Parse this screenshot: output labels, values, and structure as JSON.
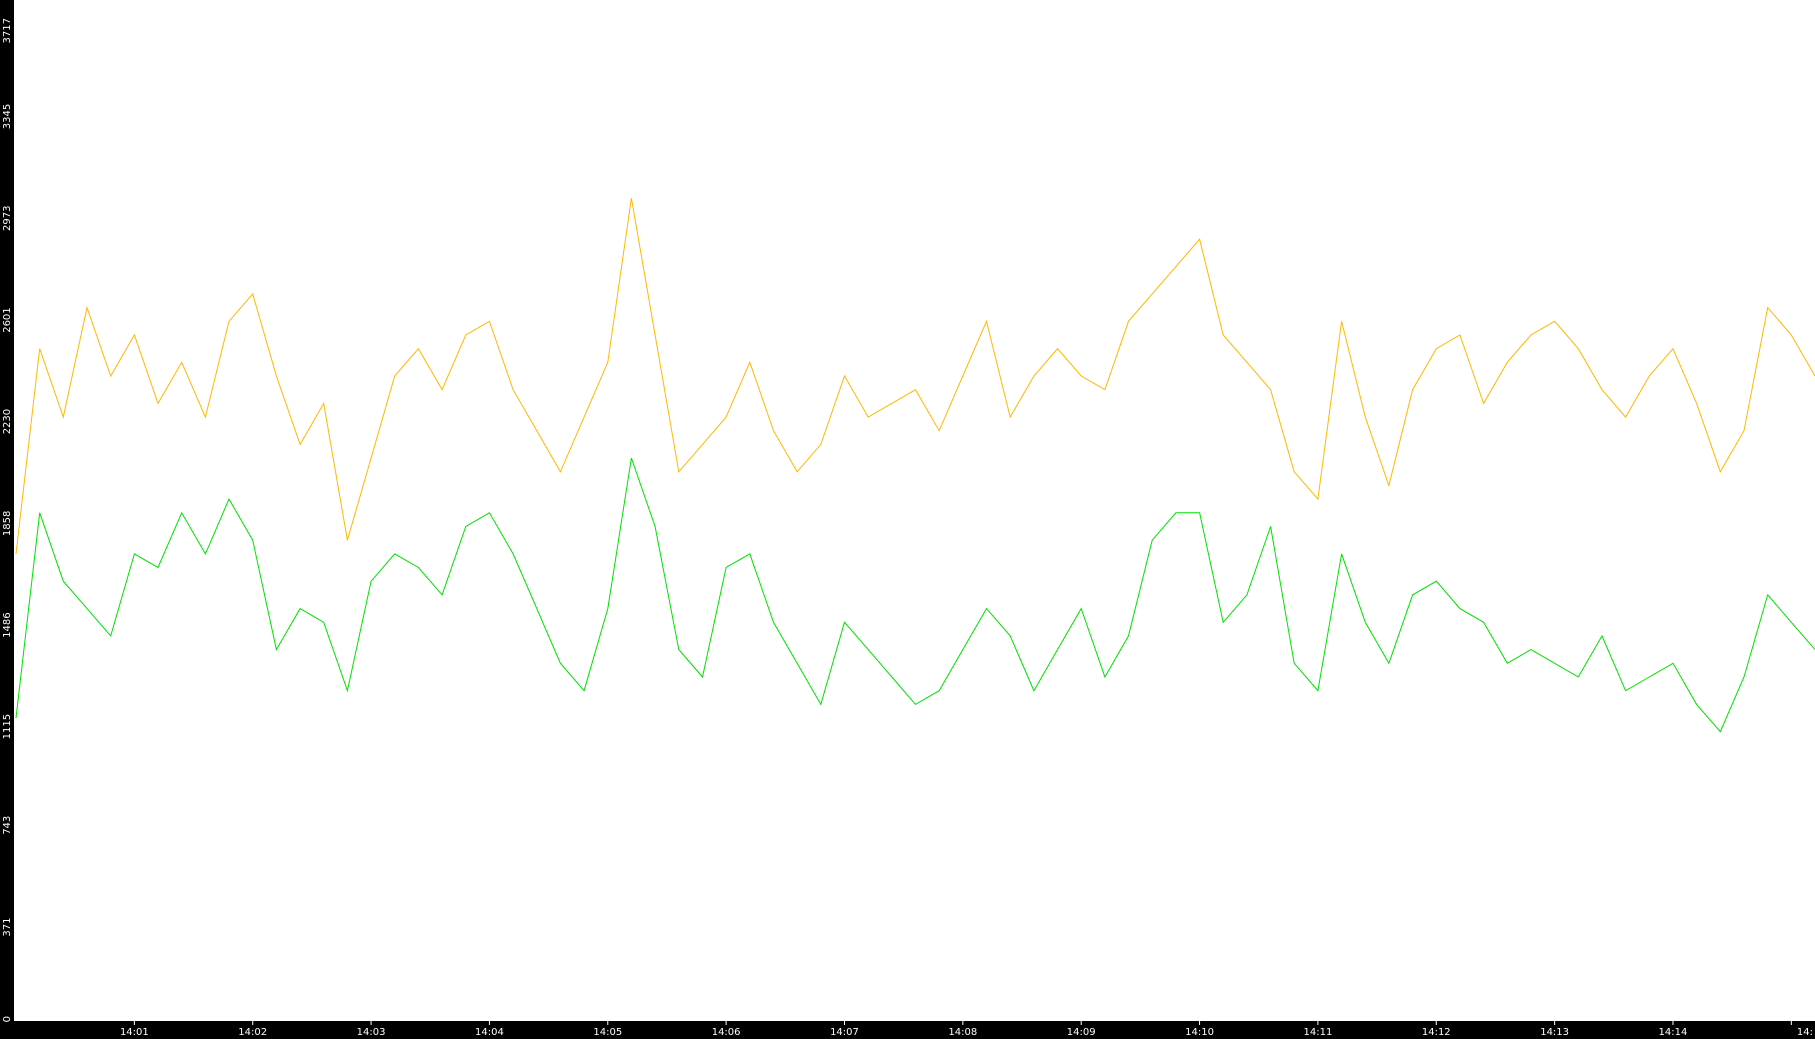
{
  "chart_data": {
    "type": "line",
    "y_ticks": [
      "0",
      "371",
      "743",
      "1115",
      "1486",
      "1858",
      "2230",
      "2601",
      "2973",
      "3345",
      "3717"
    ],
    "ylim": [
      0,
      3717
    ],
    "x_ticks": [
      "14:01",
      "14:02",
      "14:03",
      "14:04",
      "14:05",
      "14:06",
      "14:07",
      "14:08",
      "14:09",
      "14:10",
      "14:11",
      "14:12",
      "14:13",
      "14:14",
      "14:"
    ],
    "x_range_minutes": [
      0,
      15.2
    ],
    "grid": false,
    "series": [
      {
        "color": "#ffb800",
        "points": [
          [
            0.0,
            1700
          ],
          [
            0.2,
            2450
          ],
          [
            0.4,
            2200
          ],
          [
            0.6,
            2600
          ],
          [
            0.8,
            2350
          ],
          [
            1.0,
            2500
          ],
          [
            1.2,
            2250
          ],
          [
            1.4,
            2400
          ],
          [
            1.6,
            2200
          ],
          [
            1.8,
            2550
          ],
          [
            2.0,
            2650
          ],
          [
            2.2,
            2350
          ],
          [
            2.4,
            2100
          ],
          [
            2.6,
            2250
          ],
          [
            2.8,
            1750
          ],
          [
            3.0,
            2050
          ],
          [
            3.2,
            2350
          ],
          [
            3.4,
            2450
          ],
          [
            3.6,
            2300
          ],
          [
            3.8,
            2500
          ],
          [
            4.0,
            2550
          ],
          [
            4.2,
            2300
          ],
          [
            4.4,
            2150
          ],
          [
            4.6,
            2000
          ],
          [
            4.8,
            2200
          ],
          [
            5.0,
            2400
          ],
          [
            5.2,
            3000
          ],
          [
            5.4,
            2500
          ],
          [
            5.6,
            2000
          ],
          [
            5.8,
            2100
          ],
          [
            6.0,
            2200
          ],
          [
            6.2,
            2400
          ],
          [
            6.4,
            2150
          ],
          [
            6.6,
            2000
          ],
          [
            6.8,
            2100
          ],
          [
            7.0,
            2350
          ],
          [
            7.2,
            2200
          ],
          [
            7.4,
            2250
          ],
          [
            7.6,
            2300
          ],
          [
            7.8,
            2150
          ],
          [
            8.0,
            2350
          ],
          [
            8.2,
            2550
          ],
          [
            8.4,
            2200
          ],
          [
            8.6,
            2350
          ],
          [
            8.8,
            2450
          ],
          [
            9.0,
            2350
          ],
          [
            9.2,
            2300
          ],
          [
            9.4,
            2550
          ],
          [
            9.6,
            2650
          ],
          [
            9.8,
            2750
          ],
          [
            10.0,
            2850
          ],
          [
            10.2,
            2500
          ],
          [
            10.4,
            2400
          ],
          [
            10.6,
            2300
          ],
          [
            10.8,
            2000
          ],
          [
            11.0,
            1900
          ],
          [
            11.2,
            2550
          ],
          [
            11.4,
            2200
          ],
          [
            11.6,
            1950
          ],
          [
            11.8,
            2300
          ],
          [
            12.0,
            2450
          ],
          [
            12.2,
            2500
          ],
          [
            12.4,
            2250
          ],
          [
            12.6,
            2400
          ],
          [
            12.8,
            2500
          ],
          [
            13.0,
            2550
          ],
          [
            13.2,
            2450
          ],
          [
            13.4,
            2300
          ],
          [
            13.6,
            2200
          ],
          [
            13.8,
            2350
          ],
          [
            14.0,
            2450
          ],
          [
            14.2,
            2250
          ],
          [
            14.4,
            2000
          ],
          [
            14.6,
            2150
          ],
          [
            14.8,
            2600
          ],
          [
            15.0,
            2500
          ],
          [
            15.2,
            2350
          ]
        ]
      },
      {
        "color": "#00e000",
        "points": [
          [
            0.0,
            1100
          ],
          [
            0.2,
            1850
          ],
          [
            0.4,
            1600
          ],
          [
            0.6,
            1500
          ],
          [
            0.8,
            1400
          ],
          [
            1.0,
            1700
          ],
          [
            1.2,
            1650
          ],
          [
            1.4,
            1850
          ],
          [
            1.6,
            1700
          ],
          [
            1.8,
            1900
          ],
          [
            2.0,
            1750
          ],
          [
            2.2,
            1350
          ],
          [
            2.4,
            1500
          ],
          [
            2.6,
            1450
          ],
          [
            2.8,
            1200
          ],
          [
            3.0,
            1600
          ],
          [
            3.2,
            1700
          ],
          [
            3.4,
            1650
          ],
          [
            3.6,
            1550
          ],
          [
            3.8,
            1800
          ],
          [
            4.0,
            1850
          ],
          [
            4.2,
            1700
          ],
          [
            4.4,
            1500
          ],
          [
            4.6,
            1300
          ],
          [
            4.8,
            1200
          ],
          [
            5.0,
            1500
          ],
          [
            5.2,
            2050
          ],
          [
            5.4,
            1800
          ],
          [
            5.6,
            1350
          ],
          [
            5.8,
            1250
          ],
          [
            6.0,
            1650
          ],
          [
            6.2,
            1700
          ],
          [
            6.4,
            1450
          ],
          [
            6.6,
            1300
          ],
          [
            6.8,
            1150
          ],
          [
            7.0,
            1450
          ],
          [
            7.2,
            1350
          ],
          [
            7.4,
            1250
          ],
          [
            7.6,
            1150
          ],
          [
            7.8,
            1200
          ],
          [
            8.0,
            1350
          ],
          [
            8.2,
            1500
          ],
          [
            8.4,
            1400
          ],
          [
            8.6,
            1200
          ],
          [
            8.8,
            1350
          ],
          [
            9.0,
            1500
          ],
          [
            9.2,
            1250
          ],
          [
            9.4,
            1400
          ],
          [
            9.6,
            1750
          ],
          [
            9.8,
            1850
          ],
          [
            10.0,
            1850
          ],
          [
            10.2,
            1450
          ],
          [
            10.4,
            1550
          ],
          [
            10.6,
            1800
          ],
          [
            10.8,
            1300
          ],
          [
            11.0,
            1200
          ],
          [
            11.2,
            1700
          ],
          [
            11.4,
            1450
          ],
          [
            11.6,
            1300
          ],
          [
            11.8,
            1550
          ],
          [
            12.0,
            1600
          ],
          [
            12.2,
            1500
          ],
          [
            12.4,
            1450
          ],
          [
            12.6,
            1300
          ],
          [
            12.8,
            1350
          ],
          [
            13.0,
            1300
          ],
          [
            13.2,
            1250
          ],
          [
            13.4,
            1400
          ],
          [
            13.6,
            1200
          ],
          [
            13.8,
            1250
          ],
          [
            14.0,
            1300
          ],
          [
            14.2,
            1150
          ],
          [
            14.4,
            1050
          ],
          [
            14.6,
            1250
          ],
          [
            14.8,
            1550
          ],
          [
            15.0,
            1450
          ],
          [
            15.2,
            1350
          ]
        ]
      }
    ]
  }
}
